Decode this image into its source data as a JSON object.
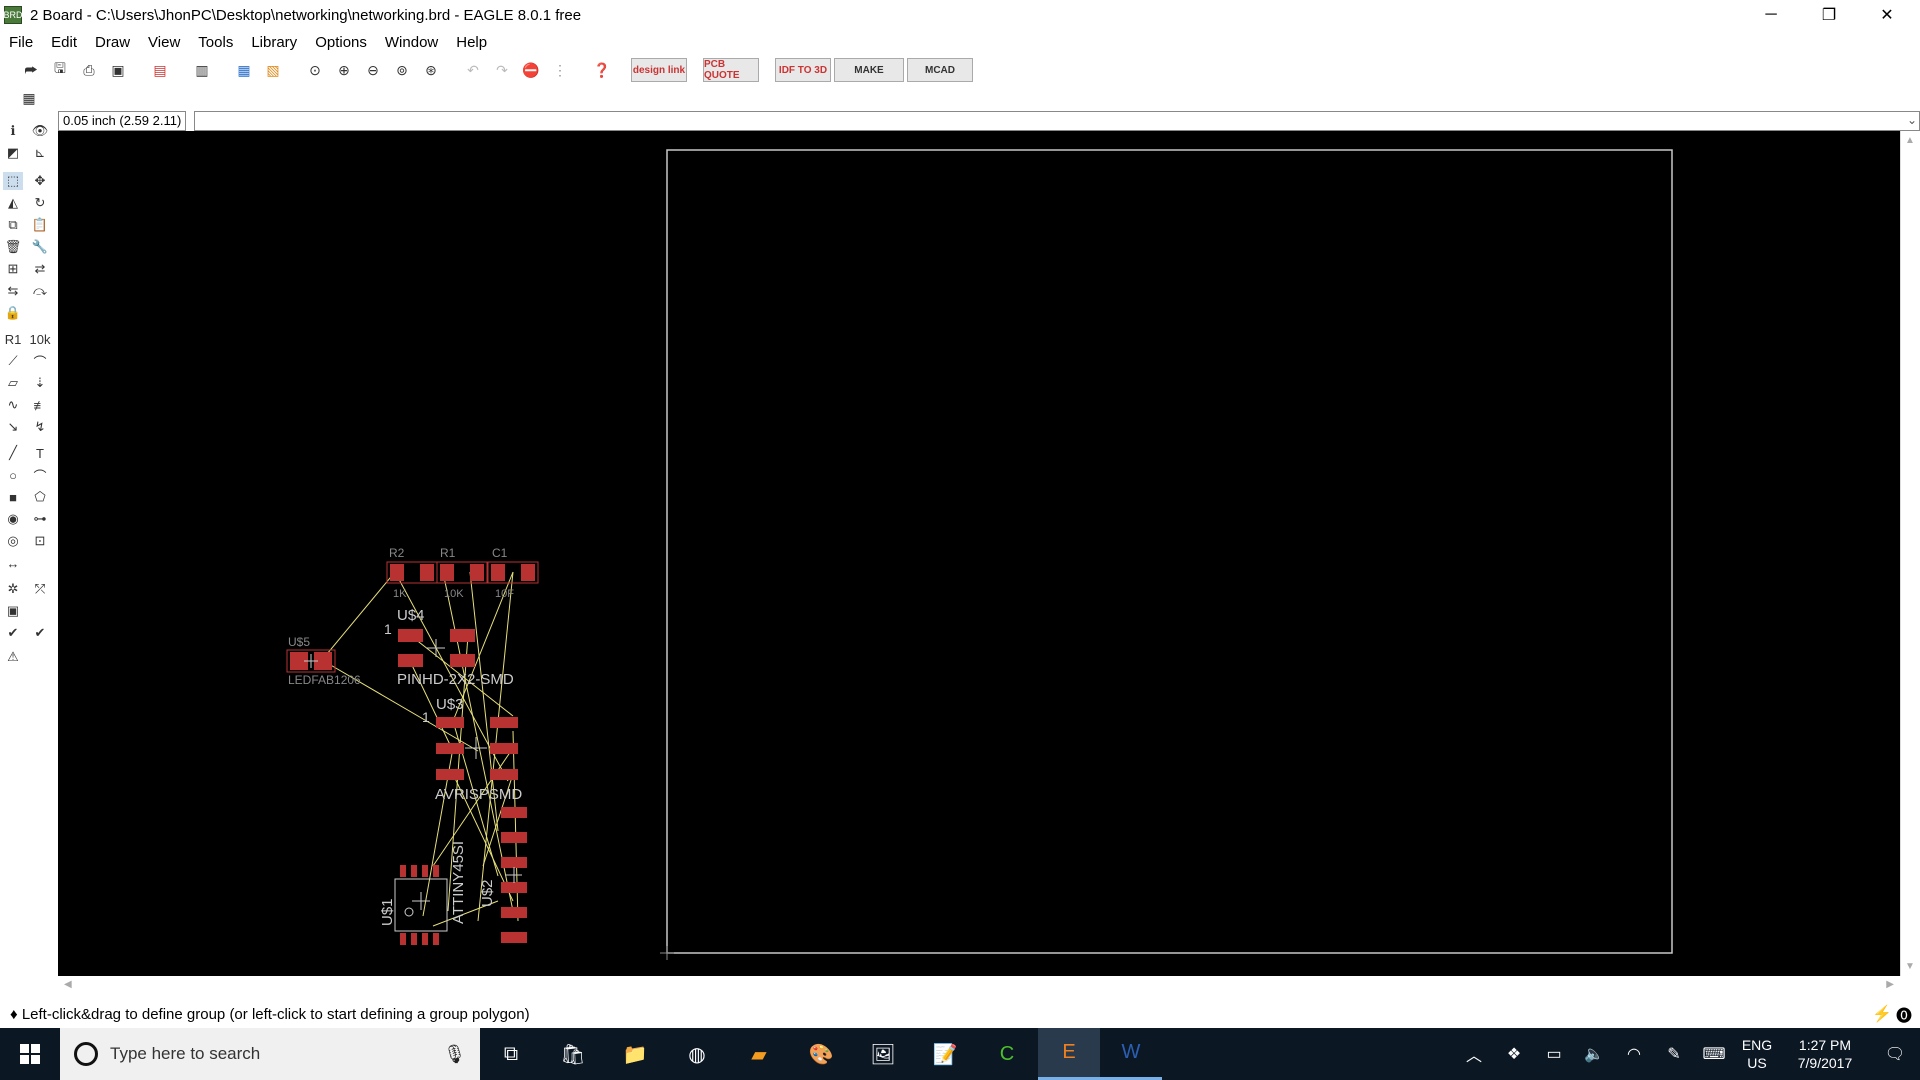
{
  "window": {
    "title": "2 Board - C:\\Users\\JhonPC\\Desktop\\networking\\networking.brd - EAGLE 8.0.1 free",
    "app_icon_label": "BRD",
    "minimize": "─",
    "restore": "❐",
    "close": "✕"
  },
  "menu": {
    "items": [
      "File",
      "Edit",
      "Draw",
      "View",
      "Tools",
      "Library",
      "Options",
      "Window",
      "Help"
    ]
  },
  "toolbar": {
    "design_link": "design link",
    "pcb_quote": "PCB QUOTE",
    "idf": "IDF TO 3D",
    "make": "MAKE",
    "mcad": "MCAD"
  },
  "coord": "0.05 inch (2.59 2.11)",
  "board": {
    "parts": [
      {
        "name": "R2",
        "value": "1K"
      },
      {
        "name": "R1",
        "value": "10K"
      },
      {
        "name": "C1",
        "value": "10F"
      },
      {
        "name": "U$4",
        "value": "PINHD-2X2-SMD",
        "pin1": "1"
      },
      {
        "name": "U$5",
        "value": "LEDFAB1206"
      },
      {
        "name": "U$3",
        "value": "AVRISPSMD",
        "pin1": "1"
      },
      {
        "name": "U$1",
        "value": "ATTINY45SI"
      },
      {
        "name": "U$2",
        "value": ""
      }
    ]
  },
  "status": "♦ Left-click&drag to define group (or left-click to start defining a group polygon)",
  "taskbar": {
    "search_placeholder": "Type here to search",
    "lang_top": "ENG",
    "lang_bottom": "US",
    "time": "1:27 PM",
    "date": "7/9/2017"
  }
}
